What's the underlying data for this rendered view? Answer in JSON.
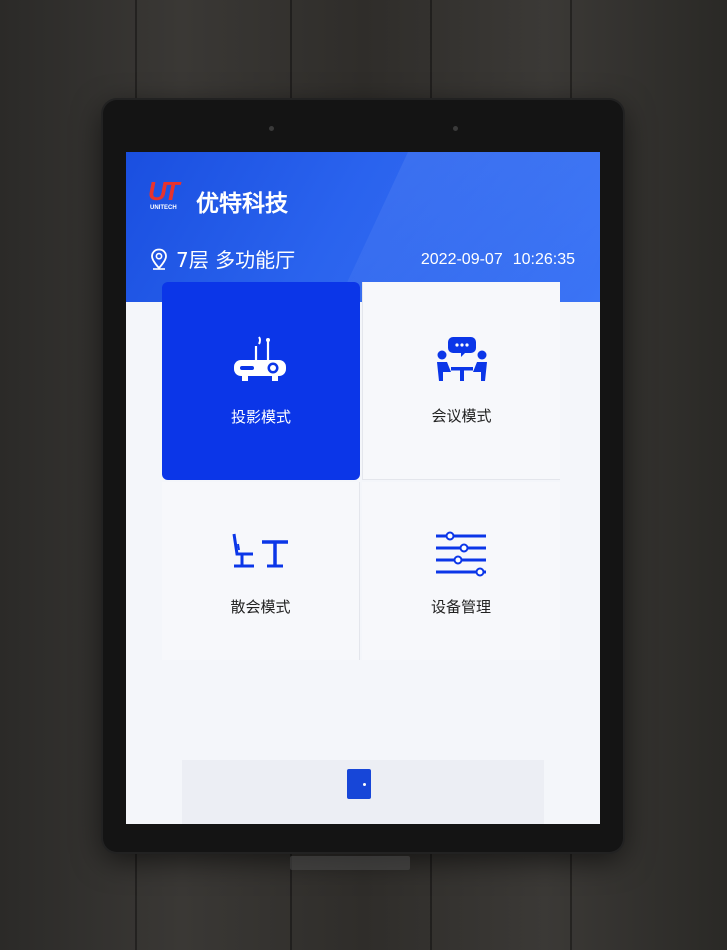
{
  "brand": {
    "logo_letters": "UT",
    "logo_sub": "UNITECH",
    "name": "优特科技",
    "accent_color": "#1a4fe0"
  },
  "header": {
    "location_icon": "location-pin-icon",
    "location": "7层 多功能厅",
    "date": "2022-09-07",
    "time": "10:26:35"
  },
  "modes": [
    {
      "label": "投影模式",
      "icon": "projector-icon",
      "active": true
    },
    {
      "label": "会议模式",
      "icon": "meeting-icon",
      "active": false
    },
    {
      "label": "散会模式",
      "icon": "dismiss-meeting-icon",
      "active": false
    },
    {
      "label": "设备管理",
      "icon": "device-settings-icon",
      "active": false
    }
  ],
  "footer": {
    "icon": "door-exit-icon"
  }
}
